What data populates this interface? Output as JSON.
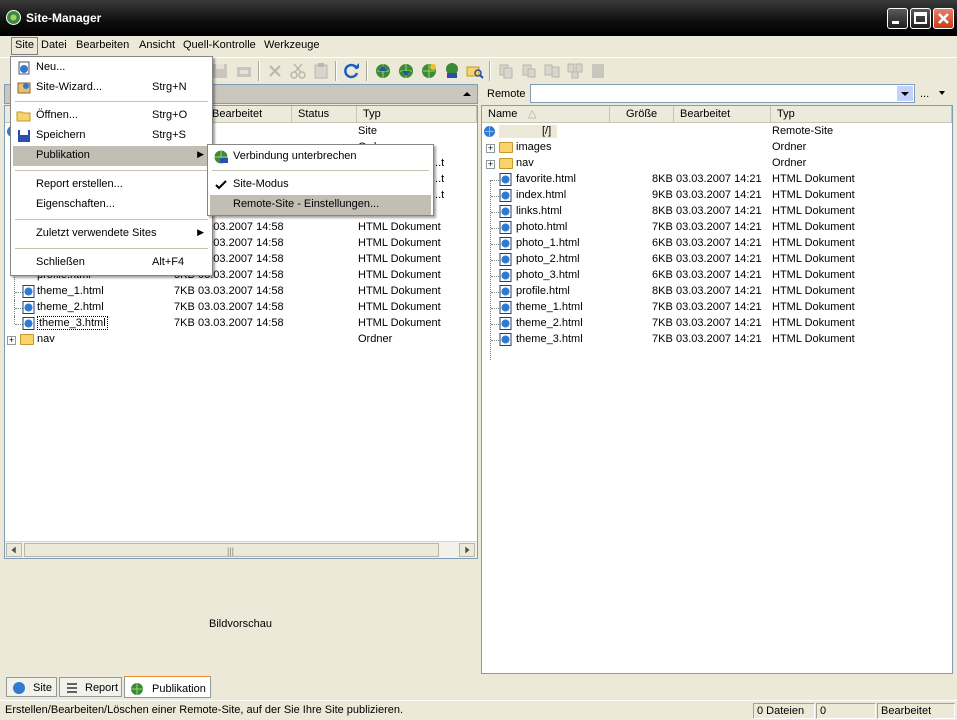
{
  "window": {
    "title": "Site-Manager"
  },
  "menubar": [
    {
      "label": "Site"
    },
    {
      "label": "Datei"
    },
    {
      "label": "Bearbeiten"
    },
    {
      "label": "Ansicht"
    },
    {
      "label": "Quell-Kontrolle"
    },
    {
      "label": "Werkzeuge"
    }
  ],
  "site_menu": {
    "items": [
      {
        "label": "Neu...",
        "shortcut": ""
      },
      {
        "label": "Site-Wizard...",
        "shortcut": "Strg+N"
      },
      {
        "label": "Öffnen...",
        "shortcut": "Strg+O"
      },
      {
        "label": "Speichern",
        "shortcut": "Strg+S"
      },
      {
        "label": "Publikation",
        "shortcut": ""
      },
      {
        "label": "Report erstellen...",
        "shortcut": ""
      },
      {
        "label": "Eigenschaften...",
        "shortcut": ""
      },
      {
        "label": "Zuletzt verwendete Sites",
        "shortcut": ""
      },
      {
        "label": "Schließen",
        "shortcut": "Alt+F4"
      }
    ]
  },
  "publish_submenu": {
    "items": [
      {
        "label": "Verbindung unterbrechen"
      },
      {
        "label": "Site-Modus"
      },
      {
        "label": "Remote-Site - Einstellungen..."
      }
    ]
  },
  "left": {
    "columns": [
      "Bearbeitet",
      "Status",
      "Typ"
    ],
    "partial_rows": [
      {
        "typ": "Site"
      },
      {
        "typ": "Ordner"
      }
    ],
    "partial_trunc": [
      "...t",
      "...t",
      "...t"
    ],
    "rows": [
      {
        "name": "",
        "size": "",
        "date": "03.03.2007 14:58",
        "typ": "HTML Dokument"
      },
      {
        "name": "",
        "size": "",
        "date": "03.03.2007 14:58",
        "typ": "HTML Dokument"
      },
      {
        "name": "",
        "size": "",
        "date": "03.03.2007 14:58",
        "typ": "HTML Dokument"
      },
      {
        "name": "profile.html",
        "size": "8KB",
        "date": "03.03.2007 14:58",
        "typ": "HTML Dokument"
      },
      {
        "name": "theme_1.html",
        "size": "7KB",
        "date": "03.03.2007 14:58",
        "typ": "HTML Dokument"
      },
      {
        "name": "theme_2.html",
        "size": "7KB",
        "date": "03.03.2007 14:58",
        "typ": "HTML Dokument"
      },
      {
        "name": "theme_3.html",
        "size": "7KB",
        "date": "03.03.2007 14:58",
        "typ": "HTML Dokument"
      },
      {
        "name": "nav",
        "size": "",
        "date": "",
        "typ": "Ordner"
      }
    ],
    "preview_label": "Bildvorschau"
  },
  "right": {
    "remote_label": "Remote",
    "remote_more": "...",
    "columns": [
      "Name",
      "Größe",
      "Bearbeitet",
      "Typ"
    ],
    "rows": [
      {
        "name": "[/]",
        "size": "",
        "date": "",
        "typ": "Remote-Site",
        "kind": "site"
      },
      {
        "name": "images",
        "size": "",
        "date": "",
        "typ": "Ordner",
        "kind": "folder"
      },
      {
        "name": "nav",
        "size": "",
        "date": "",
        "typ": "Ordner",
        "kind": "folder"
      },
      {
        "name": "favorite.html",
        "size": "8KB",
        "date": "03.03.2007 14:21",
        "typ": "HTML Dokument",
        "kind": "file"
      },
      {
        "name": "index.html",
        "size": "9KB",
        "date": "03.03.2007 14:21",
        "typ": "HTML Dokument",
        "kind": "file"
      },
      {
        "name": "links.html",
        "size": "8KB",
        "date": "03.03.2007 14:21",
        "typ": "HTML Dokument",
        "kind": "file"
      },
      {
        "name": "photo.html",
        "size": "7KB",
        "date": "03.03.2007 14:21",
        "typ": "HTML Dokument",
        "kind": "file"
      },
      {
        "name": "photo_1.html",
        "size": "6KB",
        "date": "03.03.2007 14:21",
        "typ": "HTML Dokument",
        "kind": "file"
      },
      {
        "name": "photo_2.html",
        "size": "6KB",
        "date": "03.03.2007 14:21",
        "typ": "HTML Dokument",
        "kind": "file"
      },
      {
        "name": "photo_3.html",
        "size": "6KB",
        "date": "03.03.2007 14:21",
        "typ": "HTML Dokument",
        "kind": "file"
      },
      {
        "name": "profile.html",
        "size": "8KB",
        "date": "03.03.2007 14:21",
        "typ": "HTML Dokument",
        "kind": "file"
      },
      {
        "name": "theme_1.html",
        "size": "7KB",
        "date": "03.03.2007 14:21",
        "typ": "HTML Dokument",
        "kind": "file"
      },
      {
        "name": "theme_2.html",
        "size": "7KB",
        "date": "03.03.2007 14:21",
        "typ": "HTML Dokument",
        "kind": "file"
      },
      {
        "name": "theme_3.html",
        "size": "7KB",
        "date": "03.03.2007 14:21",
        "typ": "HTML Dokument",
        "kind": "file"
      }
    ]
  },
  "tabs": [
    {
      "label": "Site"
    },
    {
      "label": "Report"
    },
    {
      "label": "Publikation"
    }
  ],
  "status": {
    "message": "Erstellen/Bearbeiten/Löschen einer Remote-Site, auf der Sie Ihre Site publizieren.",
    "files": "0 Dateien",
    "count": "0",
    "state": "Bearbeitet"
  }
}
